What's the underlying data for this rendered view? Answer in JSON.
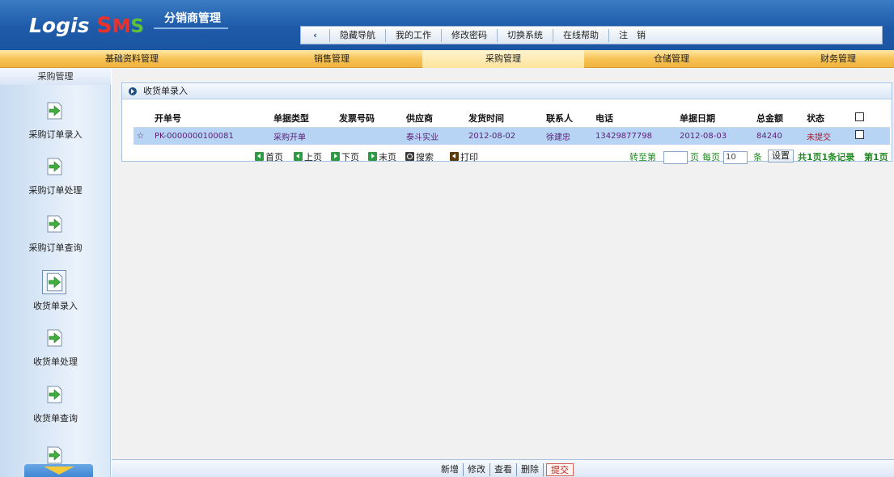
{
  "app": {
    "logo_main": "Logis",
    "logo_s": "S",
    "logo_m": "M",
    "logo_g": "S",
    "subtitle": "分销商管理"
  },
  "topnav": {
    "back_icon": "‹",
    "items": [
      "隐藏导航",
      "我的工作",
      "修改密码",
      "切换系统",
      "在线帮助",
      "注　销"
    ]
  },
  "menubar": {
    "items": [
      "基础资料管理",
      "销售管理",
      "采购管理",
      "仓储管理",
      "财务管理"
    ],
    "active_index": 2
  },
  "sidebar": {
    "title": "采购管理",
    "items": [
      {
        "label": "采购订单录入",
        "icon": "arrow-right-doc-icon"
      },
      {
        "label": "采购订单处理",
        "icon": "arrow-right-doc-icon"
      },
      {
        "label": "采购订单查询",
        "icon": "arrow-right-doc-icon"
      },
      {
        "label": "收货单录入",
        "icon": "arrow-right-doc-icon",
        "active": true
      },
      {
        "label": "收货单处理",
        "icon": "arrow-right-doc-icon"
      },
      {
        "label": "收货单查询",
        "icon": "arrow-right-doc-icon"
      }
    ]
  },
  "panel": {
    "title": "收货单录入"
  },
  "table": {
    "columns": [
      "开单号",
      "单据类型",
      "发票号码",
      "供应商",
      "发货时间",
      "联系人",
      "电话",
      "单据日期",
      "总金额",
      "状态"
    ],
    "rows": [
      {
        "marker": "☆",
        "order_no": "PK-0000000100081",
        "type": "采购开单",
        "invoice": "",
        "supplier": "泰斗实业",
        "ship_time": "2012-08-02",
        "contact": "徐建忠",
        "phone": "13429877798",
        "date": "2012-08-03",
        "amount": "84240",
        "status": "未提交"
      }
    ]
  },
  "pager": {
    "first": "首页",
    "prev": "上页",
    "next": "下页",
    "last": "末页",
    "search": "搜索",
    "print": "打印",
    "goto_label": "转至第",
    "page_unit": "页",
    "per_page_label": "每页",
    "per_page_value": "10",
    "per_page_unit": "条",
    "set_button": "设置",
    "summary": "共1页1条记录",
    "current": "第1页"
  },
  "footer": {
    "buttons": [
      "新增",
      "修改",
      "查看",
      "删除",
      "提交"
    ]
  },
  "colors": {
    "header": "#1e5aa8",
    "menubar": "#f7c356",
    "selected_row": "#b7d4f4",
    "sidebar": "#dae8f7",
    "icon_green": "#2f9a44"
  }
}
